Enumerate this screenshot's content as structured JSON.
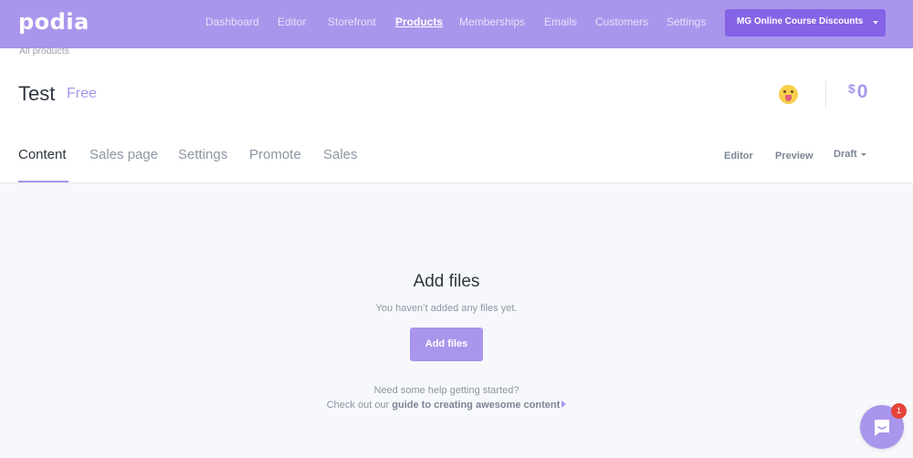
{
  "topnav": {
    "logo": "podia",
    "links": [
      "Dashboard",
      "Editor",
      "Storefront",
      "Products",
      "Memberships",
      "Emails",
      "Customers",
      "Settings"
    ],
    "active_link": "Products",
    "account_label": "MG Online Course Discounts"
  },
  "header": {
    "breadcrumb": "All products",
    "product_title": "Test",
    "price_type": "Free",
    "emoji_icon": "face-with-tongue-icon",
    "revenue_currency": "$",
    "revenue_amount": "0"
  },
  "tabs": [
    {
      "label": "Content",
      "active": true
    },
    {
      "label": "Sales page",
      "active": false
    },
    {
      "label": "Settings",
      "active": false
    },
    {
      "label": "Promote",
      "active": false
    },
    {
      "label": "Sales",
      "active": false
    }
  ],
  "actions": {
    "editor": "Editor",
    "preview": "Preview",
    "status": "Draft"
  },
  "empty_state": {
    "title": "Add files",
    "subtitle": "You haven’t added any files yet.",
    "button": "Add files",
    "help_line1": "Need some help getting started?",
    "help_line2_prefix": "Check out our ",
    "help_link": "guide to creating awesome content"
  },
  "chat": {
    "badge_count": "1"
  },
  "colors": {
    "brand": "#a996ec",
    "brand_dark": "#8463e6",
    "badge": "#e5443b"
  }
}
